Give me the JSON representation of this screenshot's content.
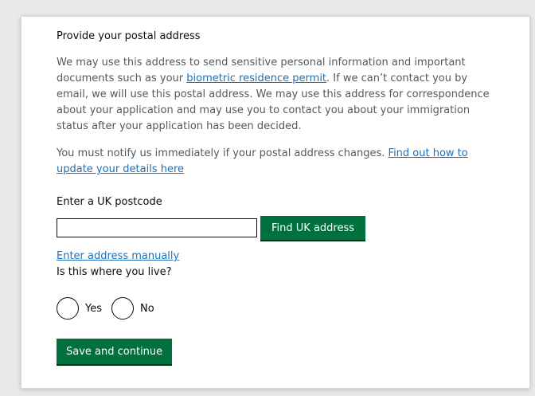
{
  "form": {
    "heading": "Provide your postal address",
    "para1": {
      "text_before": "We may use this address to send sensitive personal information and important documents such as your ",
      "link_text": "biometric residence permit",
      "text_after": ". If we can’t contact you by email, we will use this postal address. We may use this address for correspondence about your application and may use you to contact you about your immigration status after your application has been decided."
    },
    "para2": {
      "text_before": "You must notify us immediately if your postal address changes. ",
      "link_text": "Find out how to update your details here"
    },
    "postcode": {
      "label": "Enter a UK postcode",
      "value": "",
      "placeholder": ""
    },
    "find_button_label": "Find UK address",
    "manual_link_text": "Enter address manually",
    "question": "Is this where you live?",
    "radios": {
      "yes_label": "Yes",
      "no_label": "No"
    },
    "save_button_label": "Save and continue"
  },
  "colors": {
    "link": "#1d70b8",
    "button_green": "#00703c",
    "background": "#e9e9e9",
    "panel": "#ffffff"
  }
}
